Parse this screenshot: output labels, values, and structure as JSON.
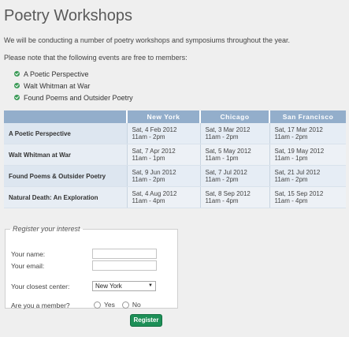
{
  "page": {
    "title": "Poetry Workshops",
    "intro_1": "We will be conducting a number of poetry workshops and symposiums throughout the year.",
    "intro_2": "Please note that the following events are free to members:"
  },
  "free_events": [
    "A Poetic Perspective",
    "Walt Whitman at War",
    "Found Poems and Outsider Poetry"
  ],
  "schedule": {
    "headers": [
      "",
      "New York",
      "Chicago",
      "San Francisco"
    ],
    "rows": [
      {
        "event": "A Poetic Perspective",
        "cells": [
          [
            "Sat, 4 Feb 2012",
            "11am - 2pm"
          ],
          [
            "Sat, 3 Mar 2012",
            "11am - 2pm"
          ],
          [
            "Sat, 17 Mar 2012",
            "11am - 2pm"
          ]
        ]
      },
      {
        "event": "Walt Whitman at War",
        "cells": [
          [
            "Sat, 7 Apr 2012",
            "11am - 1pm"
          ],
          [
            "Sat, 5 May 2012",
            "11am - 1pm"
          ],
          [
            "Sat, 19 May 2012",
            "11am - 1pm"
          ]
        ]
      },
      {
        "event": "Found Poems & Outsider Poetry",
        "cells": [
          [
            "Sat, 9 Jun 2012",
            "11am - 2pm"
          ],
          [
            "Sat, 7 Jul 2012",
            "11am - 2pm"
          ],
          [
            "Sat, 21 Jul 2012",
            "11am - 2pm"
          ]
        ]
      },
      {
        "event": "Natural Death: An Exploration",
        "cells": [
          [
            "Sat, 4 Aug 2012",
            "11am - 4pm"
          ],
          [
            "Sat, 8 Sep 2012",
            "11am - 4pm"
          ],
          [
            "Sat, 15 Sep 2012",
            "11am - 4pm"
          ]
        ]
      }
    ]
  },
  "form": {
    "legend": "Register your interest",
    "name_label": "Your name:",
    "name_value": "",
    "email_label": "Your email:",
    "email_value": "",
    "center_label": "Your closest center:",
    "center_selected": "New York",
    "member_label": "Are you a member?",
    "yes_label": "Yes",
    "no_label": "No",
    "submit_label": "Register"
  },
  "colors": {
    "table_header": "#93aecb",
    "bullet": "#3a9a56",
    "button": "#1d8f57"
  }
}
